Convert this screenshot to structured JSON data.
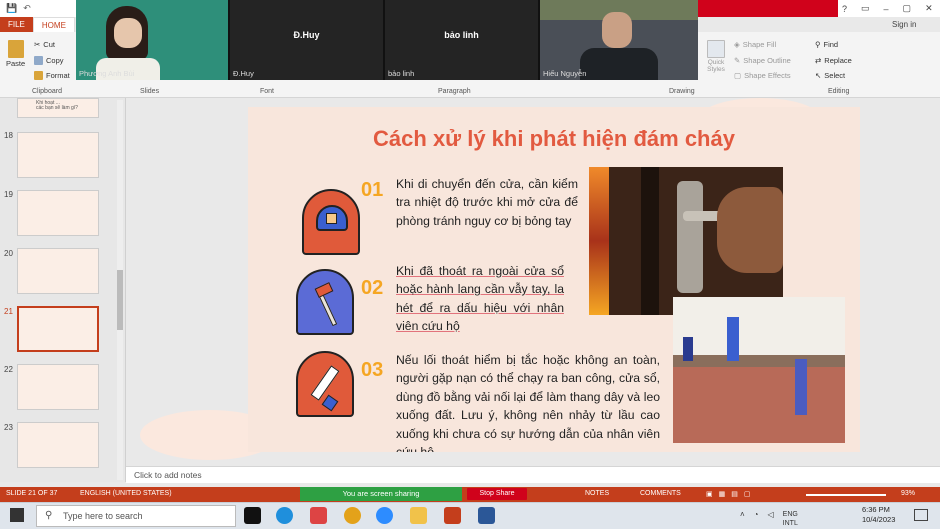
{
  "titlebar": {
    "qat": [
      "File-save",
      "Undo"
    ],
    "window_controls": [
      "?",
      "▭",
      "–",
      "▢",
      "✕"
    ],
    "sign_in": "Sign in"
  },
  "tabs": [
    "FILE",
    "HOME"
  ],
  "ribbon": {
    "clipboard": {
      "paste": "Paste",
      "cut": "Cut",
      "copy": "Copy",
      "format": "Format",
      "group": "Clipboard"
    },
    "slides_group": "Slides",
    "font_group": "Font",
    "paragraph_group": "Paragraph",
    "drawing": {
      "quick_styles": "Quick Styles",
      "shape_fill": "Shape Fill",
      "shape_outline": "Shape Outline",
      "shape_effects": "Shape Effects",
      "group": "Drawing"
    },
    "editing": {
      "find": "Find",
      "replace": "Replace",
      "select": "Select",
      "group": "Editing"
    }
  },
  "video": {
    "tiles": [
      {
        "name": "Phương Anh Bùi",
        "center": ""
      },
      {
        "name": "Đ.Huy",
        "center": "Đ.Huy"
      },
      {
        "name": "bảo linh",
        "center": "bảo linh"
      },
      {
        "name": "Hiếu Nguyễn",
        "center": ""
      }
    ]
  },
  "thumbnails": {
    "numbers": [
      "18",
      "19",
      "20",
      "21",
      "22",
      "23"
    ],
    "selected": "21",
    "top_partial_text": "Khi hoạt ...\ncác bạn sẽ làm gì?"
  },
  "slide": {
    "title": "Cách xử lý khi phát hiện đám cháy",
    "items": [
      {
        "num": "01",
        "text": "Khi di chuyển đến cửa, cần kiểm tra nhiệt độ trước khi mở cửa để phòng tránh nguy cơ bị bỏng tay"
      },
      {
        "num": "02",
        "text": "Khi đã thoát ra ngoài cửa sổ hoặc hành lang cần vẫy tay, la hét để ra dấu hiệu với nhân viên cứu hộ"
      },
      {
        "num": "03",
        "text": "Nếu lối thoát hiểm bị tắc hoặc không an toàn, người gặp nạn có thể chạy ra ban công, cửa sổ, dùng đồ bằng vải nối lại để làm thang dây và leo xuống đất. Lưu ý, không nên nhảy từ lầu cao xuống khi chưa có sự hướng dẫn của nhân viên cứu hộ."
      }
    ]
  },
  "notes": {
    "placeholder": "Click to add notes"
  },
  "status": {
    "slide": "SLIDE 21 OF 37",
    "language": "ENGLISH (UNITED STATES)",
    "sharing": "You are screen sharing",
    "stop": "Stop Share",
    "notes": "NOTES",
    "comments": "COMMENTS",
    "zoom": "93%"
  },
  "taskbar": {
    "search_placeholder": "Type here to search",
    "lang": "ENG",
    "lang2": "INTL",
    "time": "6:36 PM",
    "date": "10/4/2023"
  },
  "colors": {
    "accent": "#c43e1c",
    "title": "#e25a40",
    "number": "#f5a623",
    "slide_bg": "#f8e6dc"
  }
}
